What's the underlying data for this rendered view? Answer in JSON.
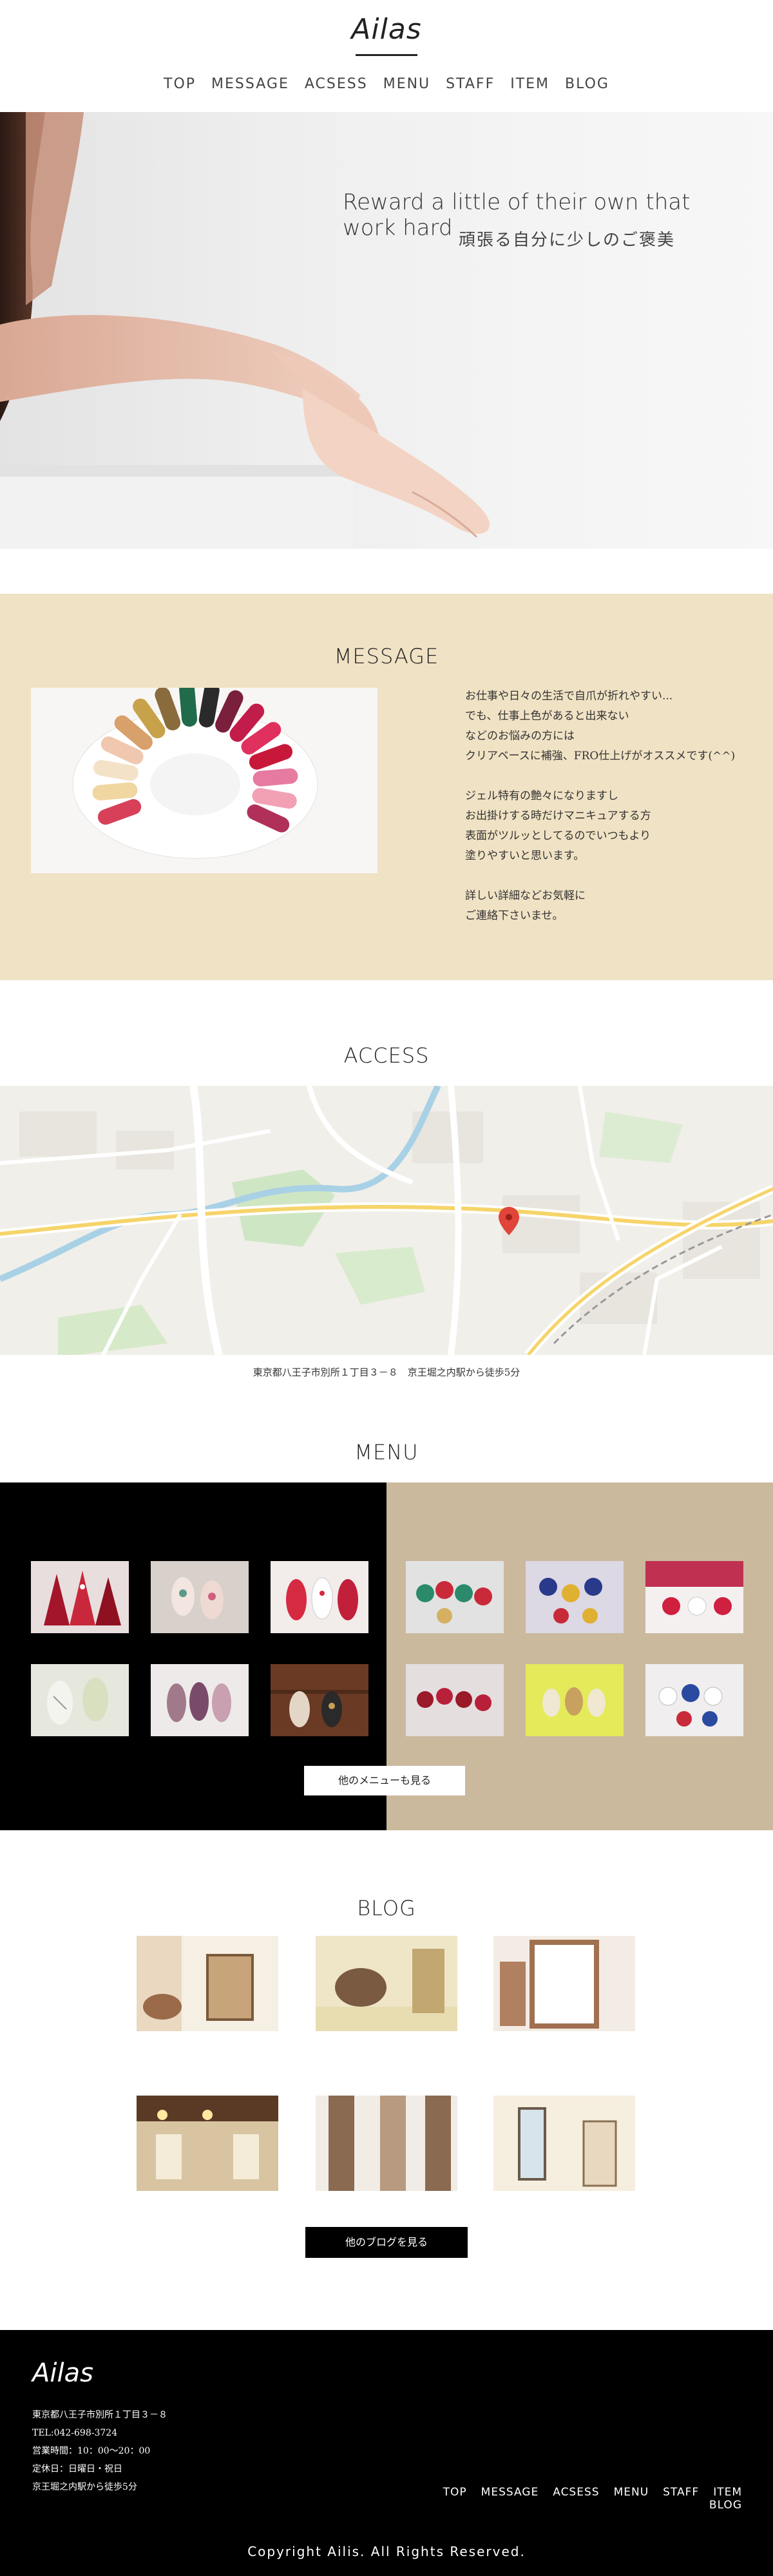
{
  "header": {
    "logo": "Ailas",
    "nav": [
      "TOP",
      "MESSAGE",
      "ACSESS",
      "MENU",
      "STAFF",
      "ITEM",
      "BLOG"
    ]
  },
  "hero": {
    "title": "Reward a little of their own that work hard",
    "subtitle": "頑張る自分に少しのご褒美"
  },
  "message": {
    "heading": "MESSAGE",
    "lines": [
      "お仕事や日々の生活で自爪が折れやすい...",
      "でも、仕事上色があると出来ない",
      "などのお悩みの方には",
      "クリアベースに補強、FRO仕上げがオススメです(^^)",
      "",
      "ジェル特有の艶々になりますし",
      "お出掛けする時だけマニキュアする方",
      "表面がツルッとしてるのでいつもより",
      "塗りやすいと思います。",
      "",
      "詳しい詳細などお気軽に",
      "ご連絡下さいませ。"
    ]
  },
  "access": {
    "heading": "ACCESS",
    "address": "東京都八王子市別所１丁目３－８　京王堀之内駅から徒歩5分"
  },
  "menu": {
    "heading": "MENU",
    "button": "他のメニューも見る"
  },
  "blog": {
    "heading": "BLOG",
    "button": "他のブログを見る"
  },
  "footer": {
    "logo": "Ailas",
    "info": [
      "東京都八王子市別所１丁目３－８",
      "TEL:042-698-3724",
      "営業時間：10：00～20：00",
      "定休日：日曜日・祝日",
      "京王堀之内駅から徒歩5分"
    ],
    "nav": [
      "TOP",
      "MESSAGE",
      "ACSESS",
      "MENU",
      "STAFF",
      "ITEM",
      "BLOG"
    ],
    "copyright": "Copyright Ailis. All Rights Reserved."
  }
}
